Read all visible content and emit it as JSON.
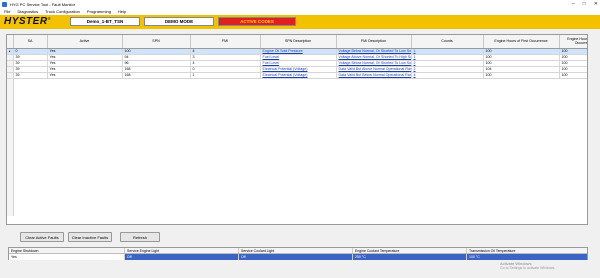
{
  "window": {
    "title": "HYG PC Service Tool - Fault Monitor"
  },
  "menu": [
    "File",
    "Diagnostics",
    "Truck Configuration",
    "Programming",
    "Help"
  ],
  "brand": {
    "logo_text": "HYSTER",
    "reg_mark": "®",
    "truck_label": "Demo_1-BT_TSN",
    "mode_label": "DEMO MODE",
    "active_label": "ACTIVE CODES"
  },
  "grid": {
    "columns": [
      "SA",
      "Active",
      "SPN",
      "FMI",
      "SPN Description",
      "FMI Description",
      "Counts",
      "Engine Hours of First Occurrence",
      "Engine Hours of Last Occurrence"
    ],
    "rows": [
      [
        "0",
        "Yes",
        "100",
        "4",
        "Engine Oil Sold Pressure",
        "Voltage Below Normal, Or Shorted To Low Sou...",
        "1",
        "100",
        "100"
      ],
      [
        "39",
        "Yes",
        "94",
        "3",
        "Fuel Level",
        "Voltage Above Normal, Or Shorted To High So...",
        "1",
        "100",
        "100"
      ],
      [
        "39",
        "Yes",
        "96",
        "4",
        "Fuel Level",
        "Voltage Below Normal, Or Shorted To Low Sou...",
        "2",
        "100",
        "100"
      ],
      [
        "39",
        "Yes",
        "168",
        "0",
        "Electrical Potential (Voltage)",
        "Data Valid But Above Normal Operational Ran...",
        "2",
        "104",
        "100"
      ],
      [
        "39",
        "Yes",
        "168",
        "1",
        "Electrical Potential (Voltage)",
        "Data Valid But Below Normal Operational Ran...",
        "4",
        "100",
        "100"
      ]
    ]
  },
  "buttons": {
    "clear_active": "Clear Active Faults",
    "clear_inactive": "Clear Inactive Faults",
    "refresh": "Refresh"
  },
  "status": {
    "headers": [
      "Engine Shutdown",
      "Service Engine Light",
      "Service Coolant Light",
      "Engine Coolant Temperature",
      "Transmission Oil Temperature"
    ],
    "values": [
      "Yes",
      "Off",
      "Off",
      "250 °C",
      "100 °C"
    ]
  },
  "watermark": {
    "line1": "Activate Windows",
    "line2": "Go to Settings to activate Windows."
  },
  "colors": {
    "brand_yellow": "#f2c200",
    "active_red": "#e02020",
    "status_blue": "#3b64c4"
  }
}
